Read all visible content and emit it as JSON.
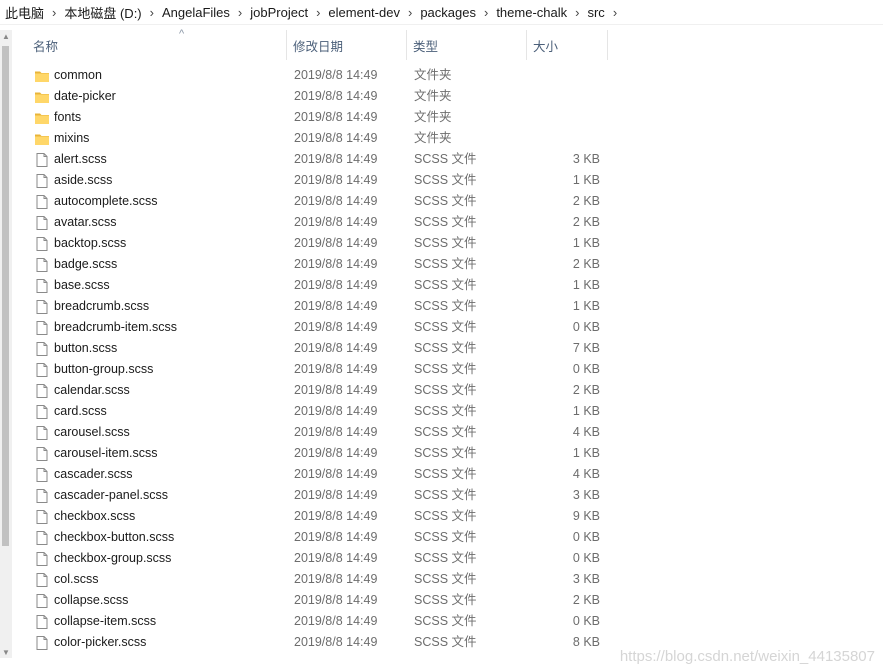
{
  "breadcrumb": [
    "此电脑",
    "本地磁盘 (D:)",
    "AngelaFiles",
    "jobProject",
    "element-dev",
    "packages",
    "theme-chalk",
    "src"
  ],
  "breadcrumb_separator": "›",
  "columns": {
    "name": "名称",
    "modified": "修改日期",
    "type": "类型",
    "size": "大小"
  },
  "colors": {
    "folder": "#ffd769",
    "folder_dark": "#e8b43a",
    "header_text": "#4c607a",
    "secondary_text": "#6d6d6d"
  },
  "files": [
    {
      "name": "common",
      "date": "2019/8/8 14:49",
      "type": "文件夹",
      "size": "",
      "icon": "folder-icon"
    },
    {
      "name": "date-picker",
      "date": "2019/8/8 14:49",
      "type": "文件夹",
      "size": "",
      "icon": "folder-icon"
    },
    {
      "name": "fonts",
      "date": "2019/8/8 14:49",
      "type": "文件夹",
      "size": "",
      "icon": "folder-icon"
    },
    {
      "name": "mixins",
      "date": "2019/8/8 14:49",
      "type": "文件夹",
      "size": "",
      "icon": "folder-icon"
    },
    {
      "name": "alert.scss",
      "date": "2019/8/8 14:49",
      "type": "SCSS 文件",
      "size": "3 KB",
      "icon": "file-icon"
    },
    {
      "name": "aside.scss",
      "date": "2019/8/8 14:49",
      "type": "SCSS 文件",
      "size": "1 KB",
      "icon": "file-icon"
    },
    {
      "name": "autocomplete.scss",
      "date": "2019/8/8 14:49",
      "type": "SCSS 文件",
      "size": "2 KB",
      "icon": "file-icon"
    },
    {
      "name": "avatar.scss",
      "date": "2019/8/8 14:49",
      "type": "SCSS 文件",
      "size": "2 KB",
      "icon": "file-icon"
    },
    {
      "name": "backtop.scss",
      "date": "2019/8/8 14:49",
      "type": "SCSS 文件",
      "size": "1 KB",
      "icon": "file-icon"
    },
    {
      "name": "badge.scss",
      "date": "2019/8/8 14:49",
      "type": "SCSS 文件",
      "size": "2 KB",
      "icon": "file-icon"
    },
    {
      "name": "base.scss",
      "date": "2019/8/8 14:49",
      "type": "SCSS 文件",
      "size": "1 KB",
      "icon": "file-icon"
    },
    {
      "name": "breadcrumb.scss",
      "date": "2019/8/8 14:49",
      "type": "SCSS 文件",
      "size": "1 KB",
      "icon": "file-icon"
    },
    {
      "name": "breadcrumb-item.scss",
      "date": "2019/8/8 14:49",
      "type": "SCSS 文件",
      "size": "0 KB",
      "icon": "file-icon"
    },
    {
      "name": "button.scss",
      "date": "2019/8/8 14:49",
      "type": "SCSS 文件",
      "size": "7 KB",
      "icon": "file-icon"
    },
    {
      "name": "button-group.scss",
      "date": "2019/8/8 14:49",
      "type": "SCSS 文件",
      "size": "0 KB",
      "icon": "file-icon"
    },
    {
      "name": "calendar.scss",
      "date": "2019/8/8 14:49",
      "type": "SCSS 文件",
      "size": "2 KB",
      "icon": "file-icon"
    },
    {
      "name": "card.scss",
      "date": "2019/8/8 14:49",
      "type": "SCSS 文件",
      "size": "1 KB",
      "icon": "file-icon"
    },
    {
      "name": "carousel.scss",
      "date": "2019/8/8 14:49",
      "type": "SCSS 文件",
      "size": "4 KB",
      "icon": "file-icon"
    },
    {
      "name": "carousel-item.scss",
      "date": "2019/8/8 14:49",
      "type": "SCSS 文件",
      "size": "1 KB",
      "icon": "file-icon"
    },
    {
      "name": "cascader.scss",
      "date": "2019/8/8 14:49",
      "type": "SCSS 文件",
      "size": "4 KB",
      "icon": "file-icon"
    },
    {
      "name": "cascader-panel.scss",
      "date": "2019/8/8 14:49",
      "type": "SCSS 文件",
      "size": "3 KB",
      "icon": "file-icon"
    },
    {
      "name": "checkbox.scss",
      "date": "2019/8/8 14:49",
      "type": "SCSS 文件",
      "size": "9 KB",
      "icon": "file-icon"
    },
    {
      "name": "checkbox-button.scss",
      "date": "2019/8/8 14:49",
      "type": "SCSS 文件",
      "size": "0 KB",
      "icon": "file-icon"
    },
    {
      "name": "checkbox-group.scss",
      "date": "2019/8/8 14:49",
      "type": "SCSS 文件",
      "size": "0 KB",
      "icon": "file-icon"
    },
    {
      "name": "col.scss",
      "date": "2019/8/8 14:49",
      "type": "SCSS 文件",
      "size": "3 KB",
      "icon": "file-icon"
    },
    {
      "name": "collapse.scss",
      "date": "2019/8/8 14:49",
      "type": "SCSS 文件",
      "size": "2 KB",
      "icon": "file-icon"
    },
    {
      "name": "collapse-item.scss",
      "date": "2019/8/8 14:49",
      "type": "SCSS 文件",
      "size": "0 KB",
      "icon": "file-icon"
    },
    {
      "name": "color-picker.scss",
      "date": "2019/8/8 14:49",
      "type": "SCSS 文件",
      "size": "8 KB",
      "icon": "file-icon"
    }
  ],
  "watermark": "https://blog.csdn.net/weixin_44135807"
}
